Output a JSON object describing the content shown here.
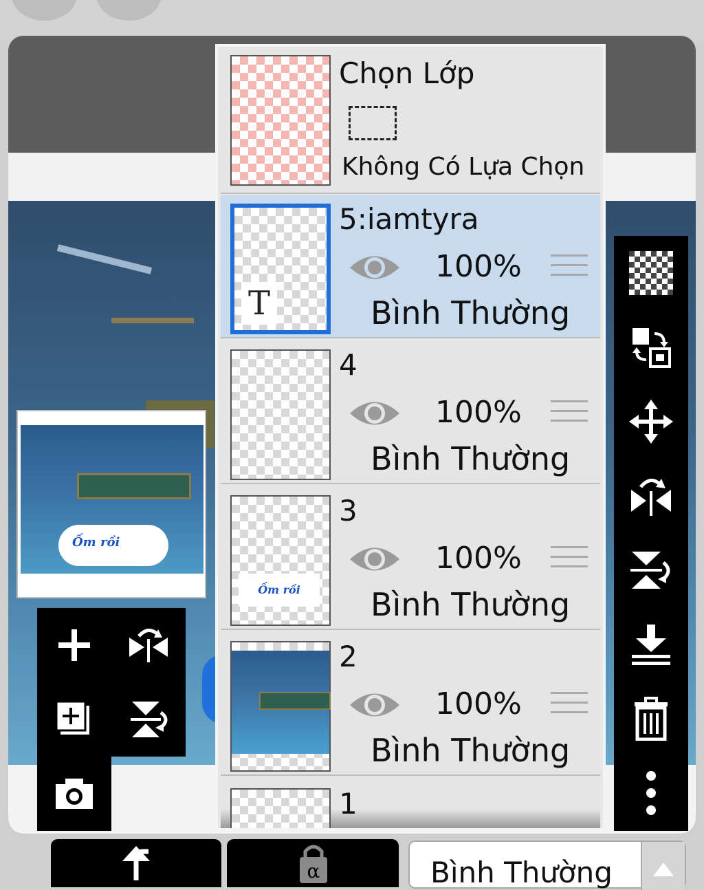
{
  "selection_layer": {
    "title": "Chọn Lớp",
    "status": "Không Có Lựa Chọn"
  },
  "layers": [
    {
      "name": "5:iamtyra",
      "opacity": "100%",
      "blend": "Bình Thường",
      "selected": true,
      "visible": true
    },
    {
      "name": "4",
      "opacity": "100%",
      "blend": "Bình Thường",
      "selected": false,
      "visible": true
    },
    {
      "name": "3",
      "opacity": "100%",
      "blend": "Bình Thường",
      "selected": false,
      "visible": true
    },
    {
      "name": "2",
      "opacity": "100%",
      "blend": "Bình Thường",
      "selected": false,
      "visible": true
    },
    {
      "name": "1"
    }
  ],
  "bottom_bar": {
    "blend_mode": "Bình Thường"
  },
  "icons": {
    "left_tools": [
      "add-icon",
      "flip-horizontal-icon",
      "add-layer-icon",
      "flip-vertical-icon",
      "camera-icon"
    ],
    "right_tools": [
      "transparency-icon",
      "swap-icon",
      "move-icon",
      "flip-horizontal-icon",
      "flip-vertical-icon",
      "merge-down-icon",
      "trash-icon",
      "more-icon"
    ],
    "bottom": [
      "undo-icon",
      "alpha-lock-icon",
      "dropdown-arrow-icon"
    ]
  },
  "colors": {
    "selected_layer_bg": "#c8dbee",
    "selected_thumb_border": "#1f6fd6",
    "toolbar_bg": "#000000"
  }
}
